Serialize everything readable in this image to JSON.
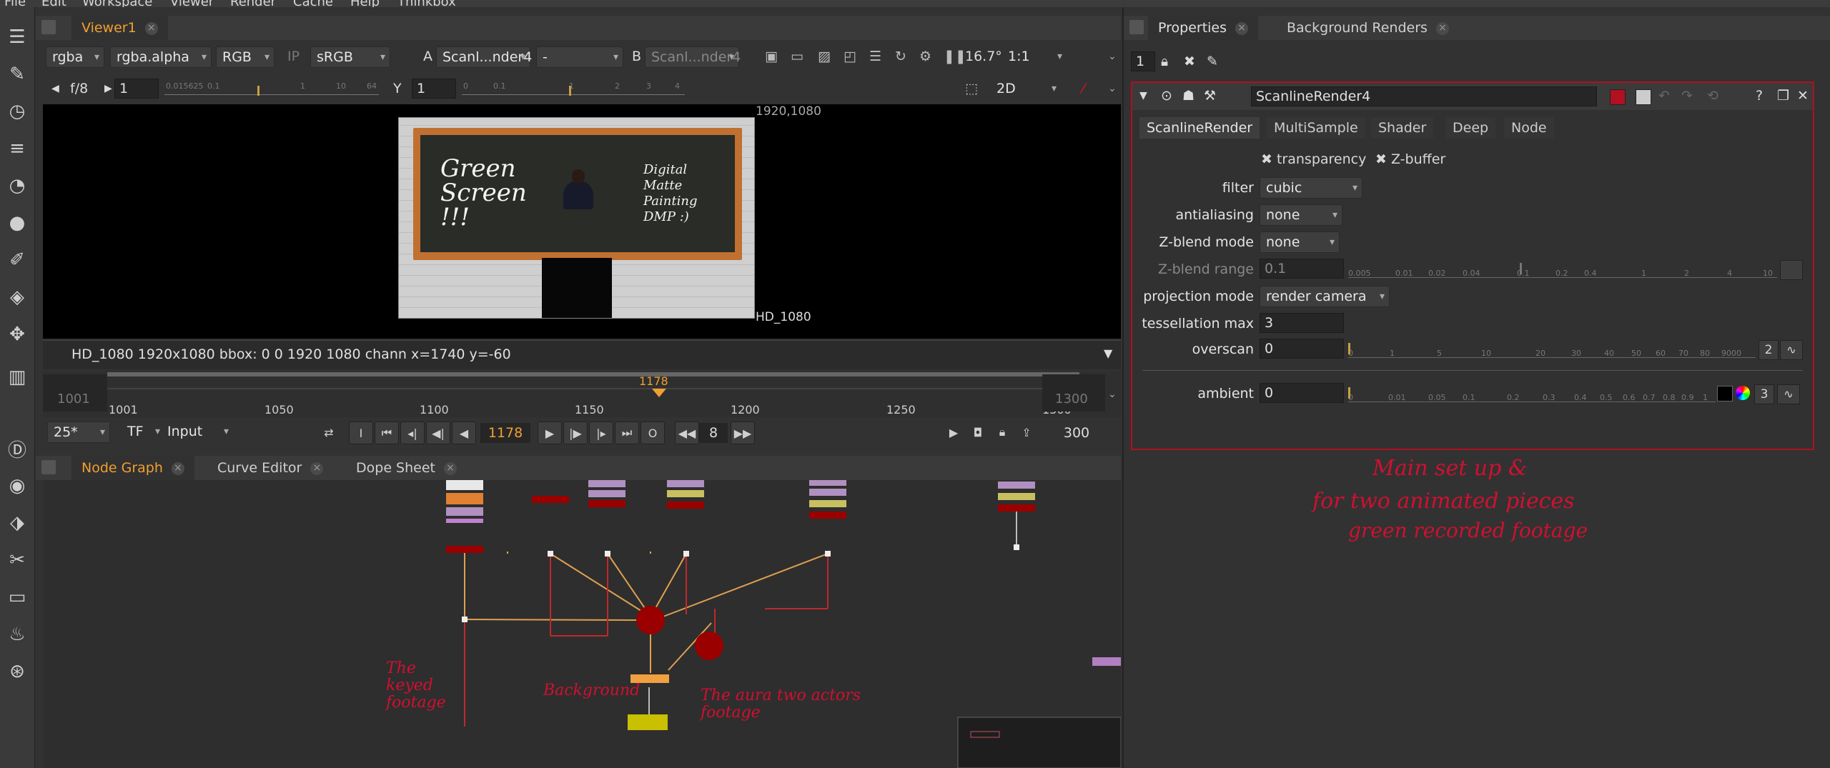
{
  "menubar": {
    "items": [
      "File",
      "Edit",
      "Workspace",
      "Viewer",
      "Render",
      "Cache",
      "Help",
      "Thinkbox"
    ]
  },
  "lefttools": [
    "select-icon",
    "paint-icon",
    "time-icon",
    "channel-icon",
    "color-icon",
    "filter-icon",
    "keyer-icon",
    "merge-icon",
    "transform-icon",
    "3d-icon",
    "deep-icon",
    "views-icon",
    "metadata-icon",
    "toolsets-icon",
    "other-icon",
    "particles-icon",
    "furnace-icon"
  ],
  "viewer": {
    "tab_label": "Viewer1",
    "channels": "rgba",
    "alpha_channel": "rgba.alpha",
    "display": "RGB",
    "ip_label": "IP",
    "lut": "sRGB",
    "input_a_label": "A",
    "input_a": "Scanl...nder4",
    "merge_op": "-",
    "input_b_label": "B",
    "input_b": "Scanl...nder4",
    "zoom": "16.7°",
    "ratio": "1:1",
    "fstop_label": "f/8",
    "gain": "1",
    "gamma_label": "Y",
    "gamma": "1",
    "gain_ticks": [
      "0.015625",
      "0.1",
      "1",
      "10",
      "64"
    ],
    "gamma_ticks": [
      "0",
      "0.1",
      "1",
      "2",
      "3",
      "4"
    ],
    "view_mode": "2D",
    "format_top": "1920,1080",
    "format_bottom": "HD_1080",
    "info": "HD_1080 1920x1080  bbox: 0 0 1920 1080 chann  x=1740 y=-60",
    "chalk_left": "Green Screen !!!",
    "chalk_right": "Digital Matte Painting DMP :)"
  },
  "timeline": {
    "start": "1001",
    "end": "1300",
    "current": "1178",
    "ticks": [
      "1001",
      "1050",
      "1100",
      "1150",
      "1200",
      "1250",
      "1300"
    ],
    "fps": "25*",
    "tf": "TF",
    "range_mode": "Input",
    "frame_display": "1178",
    "increment": "8",
    "total": "300"
  },
  "nodegraph": {
    "tabs": [
      "Node Graph",
      "Curve Editor",
      "Dope Sheet"
    ],
    "annotations": [
      "The keyed footage",
      "Background",
      "The aura two actors footage"
    ]
  },
  "properties": {
    "tabs": [
      "Properties",
      "Background Renders"
    ],
    "max_panels": "1",
    "node_name": "ScanlineRender4",
    "subtabs": [
      "ScanlineRender",
      "MultiSample",
      "Shader",
      "Deep",
      "Node"
    ],
    "transparency": "transparency",
    "zbuffer": "Z-buffer",
    "rows": [
      {
        "label": "filter",
        "value": "cubic"
      },
      {
        "label": "antialiasing",
        "value": "none"
      },
      {
        "label": "Z-blend mode",
        "value": "none"
      },
      {
        "label": "Z-blend range",
        "value": "0.1"
      },
      {
        "label": "projection mode",
        "value": "render camera"
      },
      {
        "label": "tessellation max",
        "value": "3"
      },
      {
        "label": "overscan",
        "value": "0"
      },
      {
        "label": "ambient",
        "value": "0"
      }
    ],
    "zblend_ticks": [
      "0.005",
      "0.01",
      "0.02",
      "0.04",
      "0.1",
      "0.2",
      "0.4",
      "1",
      "2",
      "4",
      "10"
    ],
    "overscan_ticks": [
      "0",
      "1",
      "5",
      "10",
      "20",
      "30",
      "40",
      "50",
      "60",
      "70",
      "80",
      "9000"
    ],
    "ambient_ticks": [
      "0",
      "0.01",
      "0.05",
      "0.1",
      "0.2",
      "0.3",
      "0.4",
      "0.5",
      "0.6",
      "0.7",
      "0.8",
      "0.9",
      "1"
    ],
    "overscan_channels": "2",
    "ambient_channels": "3",
    "note_line1": "Main set up &",
    "note_line2": "for two animated pieces",
    "note_line3": "green recorded footage"
  },
  "colors": {
    "accent": "#f0a030",
    "annotation": "#d01030",
    "node_red": "#9a0000",
    "panel_border": "#b01020"
  }
}
